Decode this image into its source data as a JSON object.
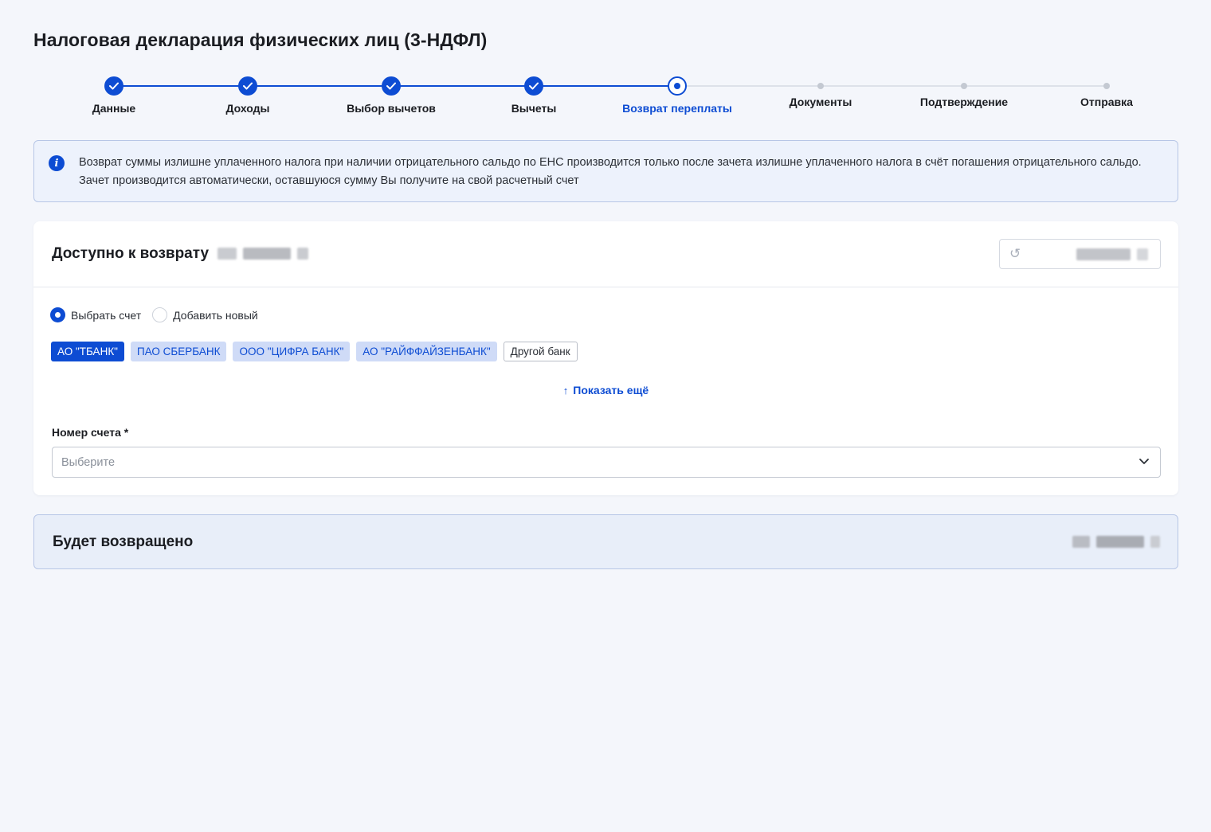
{
  "page": {
    "title": "Налоговая декларация физических лиц (3-НДФЛ)"
  },
  "stepper": {
    "steps": [
      {
        "label": "Данные",
        "state": "done"
      },
      {
        "label": "Доходы",
        "state": "done"
      },
      {
        "label": "Выбор вычетов",
        "state": "done"
      },
      {
        "label": "Вычеты",
        "state": "done"
      },
      {
        "label": "Возврат переплаты",
        "state": "current"
      },
      {
        "label": "Документы",
        "state": "todo"
      },
      {
        "label": "Подтверждение",
        "state": "todo"
      },
      {
        "label": "Отправка",
        "state": "todo"
      }
    ]
  },
  "info": {
    "text": "Возврат суммы излишне уплаченного налога при наличии отрицательного сальдо по ЕНС производится только после зачета излишне уплаченного налога в счёт погашения отрицательного сальдо. Зачет производится автоматически, оставшуюся сумму Вы получите на свой расчетный счет"
  },
  "refund_card": {
    "title": "Доступно к возврату",
    "radios": {
      "choose": "Выбрать счет",
      "add_new": "Добавить новый"
    },
    "banks": [
      "АО \"ТБАНК\"",
      "ПАО СБЕРБАНК",
      "ООО \"ЦИФРА БАНК\"",
      "АО \"РАЙФФАЙЗЕНБАНК\"",
      "Другой банк"
    ],
    "show_more": "Показать ещё",
    "account_label": "Номер счета *",
    "account_placeholder": "Выберите"
  },
  "summary": {
    "title": "Будет возвращено"
  },
  "colors": {
    "accent": "#0d4cd3",
    "background": "#f4f6fb",
    "info_bg": "#edf2fc",
    "chip_light": "#cfdbf7"
  },
  "icons": {
    "check": "check-icon",
    "info": "info-icon",
    "refresh": "refresh-icon",
    "arrow_up": "arrow-up-icon",
    "chevron": "chevron-down-icon"
  }
}
